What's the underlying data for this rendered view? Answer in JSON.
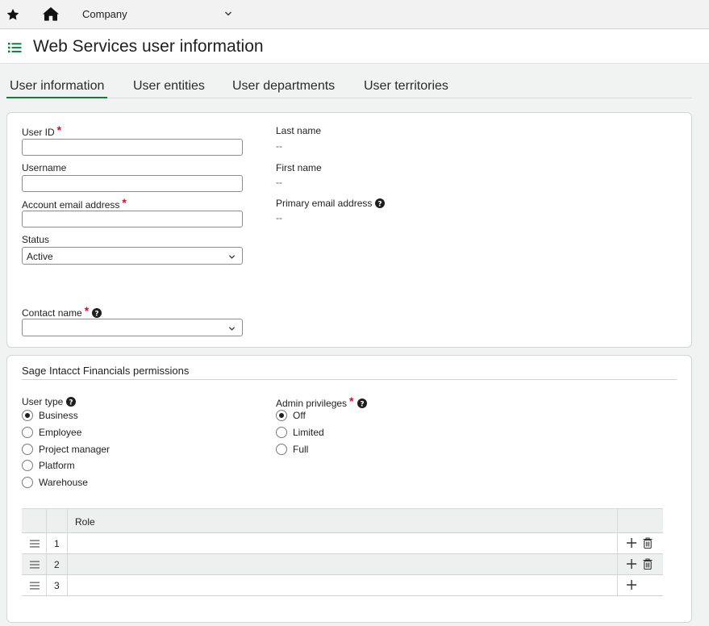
{
  "topbar": {
    "company": "Company",
    "star_icon": "star-icon",
    "home_icon": "home-icon"
  },
  "header": {
    "title": "Web Services user information"
  },
  "tabs": [
    {
      "label": "User information",
      "active": true
    },
    {
      "label": "User entities",
      "active": false
    },
    {
      "label": "User departments",
      "active": false
    },
    {
      "label": "User territories",
      "active": false
    }
  ],
  "user_info": {
    "user_id_label": "User ID",
    "user_id_value": "",
    "username_label": "Username",
    "username_value": "",
    "account_email_label": "Account email address",
    "account_email_value": "",
    "status_label": "Status",
    "status_value": "Active",
    "contact_name_label": "Contact name",
    "contact_name_value": "",
    "last_name_label": "Last name",
    "last_name_value": "--",
    "first_name_label": "First name",
    "first_name_value": "--",
    "primary_email_label": "Primary email address",
    "primary_email_value": "--",
    "required_mark": "*"
  },
  "permissions": {
    "section_title": "Sage Intacct Financials permissions",
    "user_type_label": "User type",
    "user_types": [
      {
        "label": "Business",
        "checked": true
      },
      {
        "label": "Employee",
        "checked": false
      },
      {
        "label": "Project manager",
        "checked": false
      },
      {
        "label": "Platform",
        "checked": false
      },
      {
        "label": "Warehouse",
        "checked": false
      }
    ],
    "admin_label": "Admin privileges",
    "admin_options": [
      {
        "label": "Off",
        "checked": true
      },
      {
        "label": "Limited",
        "checked": false
      },
      {
        "label": "Full",
        "checked": false
      }
    ]
  },
  "roles_grid": {
    "column_role": "Role",
    "rows": [
      {
        "num": "1",
        "role": ""
      },
      {
        "num": "2",
        "role": ""
      },
      {
        "num": "3",
        "role": ""
      }
    ]
  },
  "colors": {
    "accent": "#0f7b3f",
    "required": "#c8102e"
  }
}
